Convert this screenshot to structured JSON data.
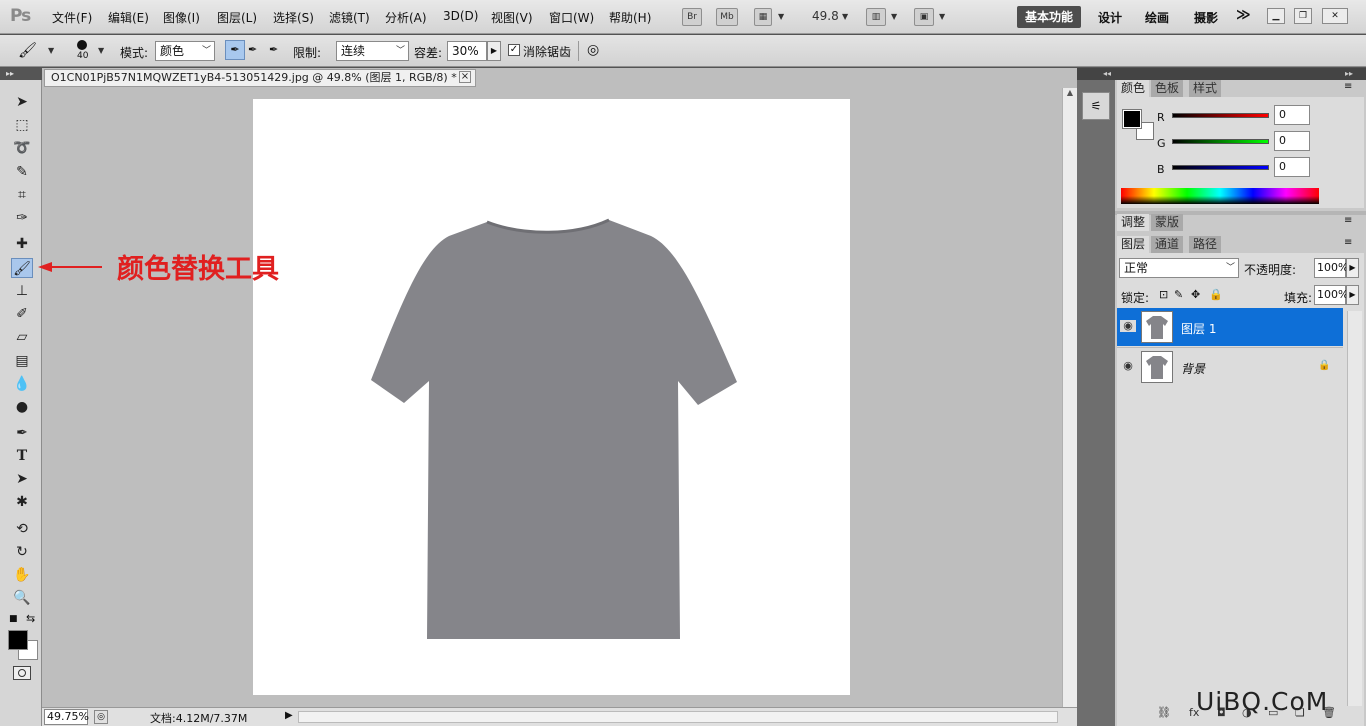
{
  "app": {
    "logo": "Ps"
  },
  "menu": [
    "文件(F)",
    "编辑(E)",
    "图像(I)",
    "图层(L)",
    "选择(S)",
    "滤镜(T)",
    "分析(A)",
    "3D(D)",
    "视图(V)",
    "窗口(W)",
    "帮助(H)"
  ],
  "appbar": {
    "br": "Br",
    "mb": "Mb",
    "zoom": "49.8"
  },
  "workspaces": {
    "active": "基本功能",
    "others": [
      "设计",
      "绘画",
      "摄影"
    ],
    "more": "≫"
  },
  "options": {
    "brush_size": "40",
    "mode_label": "模式:",
    "mode_value": "颜色",
    "limit_label": "限制:",
    "limit_value": "连续",
    "tolerance_label": "容差:",
    "tolerance_value": "30%",
    "antialias_label": "消除锯齿",
    "antialias_checked": true
  },
  "document": {
    "tab_title": "O1CN01PjB57N1MQWZET1yB4-513051429.jpg @ 49.8% (图层 1, RGB/8) *",
    "close": "×",
    "shirt_color": "#85858a",
    "canvas_color": "#ffffff"
  },
  "status": {
    "zoom": "49.75%",
    "doc_info": "文档:4.12M/7.37M"
  },
  "color_panel": {
    "tabs": [
      "颜色",
      "色板",
      "样式"
    ],
    "channels": [
      {
        "label": "R",
        "value": "0"
      },
      {
        "label": "G",
        "value": "0"
      },
      {
        "label": "B",
        "value": "0"
      }
    ],
    "foreground": "#000000",
    "background": "#ffffff"
  },
  "adjust_panel": {
    "tabs": [
      "调整",
      "蒙版"
    ]
  },
  "layers_panel": {
    "tabs": [
      "图层",
      "通道",
      "路径"
    ],
    "blend_mode": "正常",
    "opacity_label": "不透明度:",
    "opacity_value": "100%",
    "lock_label": "锁定:",
    "fill_label": "填充:",
    "fill_value": "100%",
    "layers": [
      {
        "name": "图层 1",
        "selected": true
      },
      {
        "name": "背景",
        "selected": false,
        "locked": true
      }
    ]
  },
  "annotation": {
    "text": "颜色替换工具",
    "color": "#e02020"
  },
  "watermark": "UiBQ.CoM",
  "colors": {
    "selection": "#0e6fd7",
    "menubar": "#dadada",
    "docbg": "#bebebe"
  }
}
